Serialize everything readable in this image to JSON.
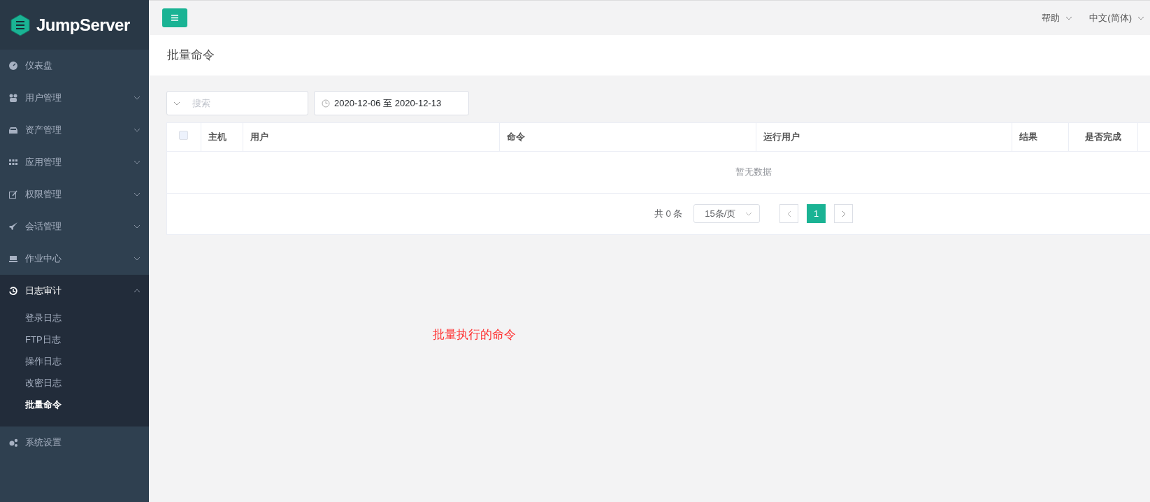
{
  "sidebar": {
    "logo": "JumpServer",
    "items": [
      {
        "kind": "link",
        "label": "仪表盘",
        "selected": false
      },
      {
        "kind": "group",
        "label": "用户管理",
        "expanded": false
      },
      {
        "kind": "group",
        "label": "资产管理",
        "expanded": false
      },
      {
        "kind": "group",
        "label": "应用管理",
        "expanded": false
      },
      {
        "kind": "group",
        "label": "权限管理",
        "expanded": false
      },
      {
        "kind": "group",
        "label": "会话管理",
        "expanded": false
      },
      {
        "kind": "group",
        "label": "作业中心",
        "expanded": false
      },
      {
        "kind": "group",
        "label": "日志审计",
        "expanded": true,
        "children": [
          {
            "label": "登录日志",
            "selected": false
          },
          {
            "label": "FTP日志",
            "selected": false
          },
          {
            "label": "操作日志",
            "selected": false
          },
          {
            "label": "改密日志",
            "selected": false
          },
          {
            "label": "批量命令",
            "selected": true
          }
        ]
      },
      {
        "kind": "link",
        "label": "系统设置",
        "selected": false
      }
    ]
  },
  "topbar": {
    "menus": [
      "帮助",
      "中文(简体)"
    ]
  },
  "page_title": "批量命令",
  "filters": {
    "search": {
      "placeholder": "搜索"
    },
    "date_range": {
      "start": "2020-12-06",
      "separator": "至",
      "end": "2020-12-13"
    }
  },
  "table": {
    "select_all": {
      "checked": false
    },
    "columns": [
      "主机",
      "用户",
      "命令",
      "运行用户",
      "结果",
      "是否完成"
    ],
    "empty_text": "暂无数据"
  },
  "pagination": {
    "total": "共 0 条",
    "page_size": "15条/页",
    "pages": [
      {
        "label": "1",
        "selected": true
      }
    ]
  },
  "annotation": "批量执行的命令"
}
